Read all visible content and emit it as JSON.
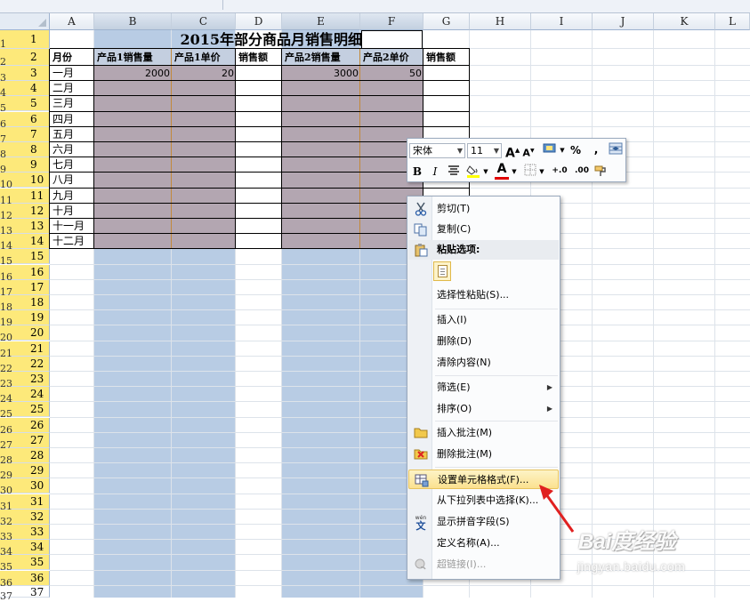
{
  "columns": [
    "A",
    "B",
    "C",
    "D",
    "E",
    "F",
    "G",
    "H",
    "I",
    "J",
    "K",
    "L"
  ],
  "rows": [
    "1",
    "2",
    "3",
    "4",
    "5",
    "6",
    "7",
    "8",
    "9",
    "10",
    "11",
    "12",
    "13",
    "14",
    "15",
    "16",
    "17",
    "18",
    "19",
    "20",
    "21",
    "22",
    "23",
    "24",
    "25",
    "26",
    "27",
    "28",
    "29",
    "30",
    "31",
    "32",
    "33",
    "34",
    "35",
    "36",
    "37"
  ],
  "sheet": {
    "title": "2015年部分商品月销售明细",
    "headers": [
      "月份",
      "产品1销售量",
      "产品1单价",
      "销售额",
      "产品2销售量",
      "产品2单价",
      "销售额"
    ],
    "months": [
      "一月",
      "二月",
      "三月",
      "四月",
      "五月",
      "六月",
      "七月",
      "八月",
      "九月",
      "十月",
      "十一月",
      "十二月"
    ],
    "row3": {
      "b": "2000",
      "c": "20",
      "e": "3000",
      "f": "50"
    }
  },
  "mini_toolbar": {
    "font_name": "宋体",
    "font_size": "11",
    "bold": "B",
    "italic": "I",
    "percent": "%",
    "comma": ",",
    "inc_decimal": "+.0",
    "dec_decimal": ".00",
    "grow_font": "A",
    "shrink_font": "A",
    "font_color_letter": "A"
  },
  "context_menu": {
    "cut": "剪切(T)",
    "copy": "复制(C)",
    "paste_options": "粘贴选项:",
    "paste_special": "选择性粘贴(S)...",
    "insert": "插入(I)",
    "delete": "删除(D)",
    "clear_contents": "清除内容(N)",
    "filter": "筛选(E)",
    "sort": "排序(O)",
    "insert_comment": "插入批注(M)",
    "delete_comment": "删除批注(M)",
    "format_cells": "设置单元格格式(F)...",
    "pick_from_list": "从下拉列表中选择(K)...",
    "show_phonetic": "显示拼音字段(S)",
    "define_name": "定义名称(A)...",
    "hyperlink": "超链接(I)...",
    "phonetic_icon_text": "文",
    "phonetic_icon_small": "wén"
  },
  "watermark": {
    "name": "Bai度经验",
    "url": "jingyan.baidu.com"
  },
  "colors": {
    "selected_fill": "#b8cce4",
    "table_fill": "#b3a6b1",
    "highlight": "#fbe18f",
    "arrow": "#e02020",
    "row_header_sel": "#fde97a"
  }
}
